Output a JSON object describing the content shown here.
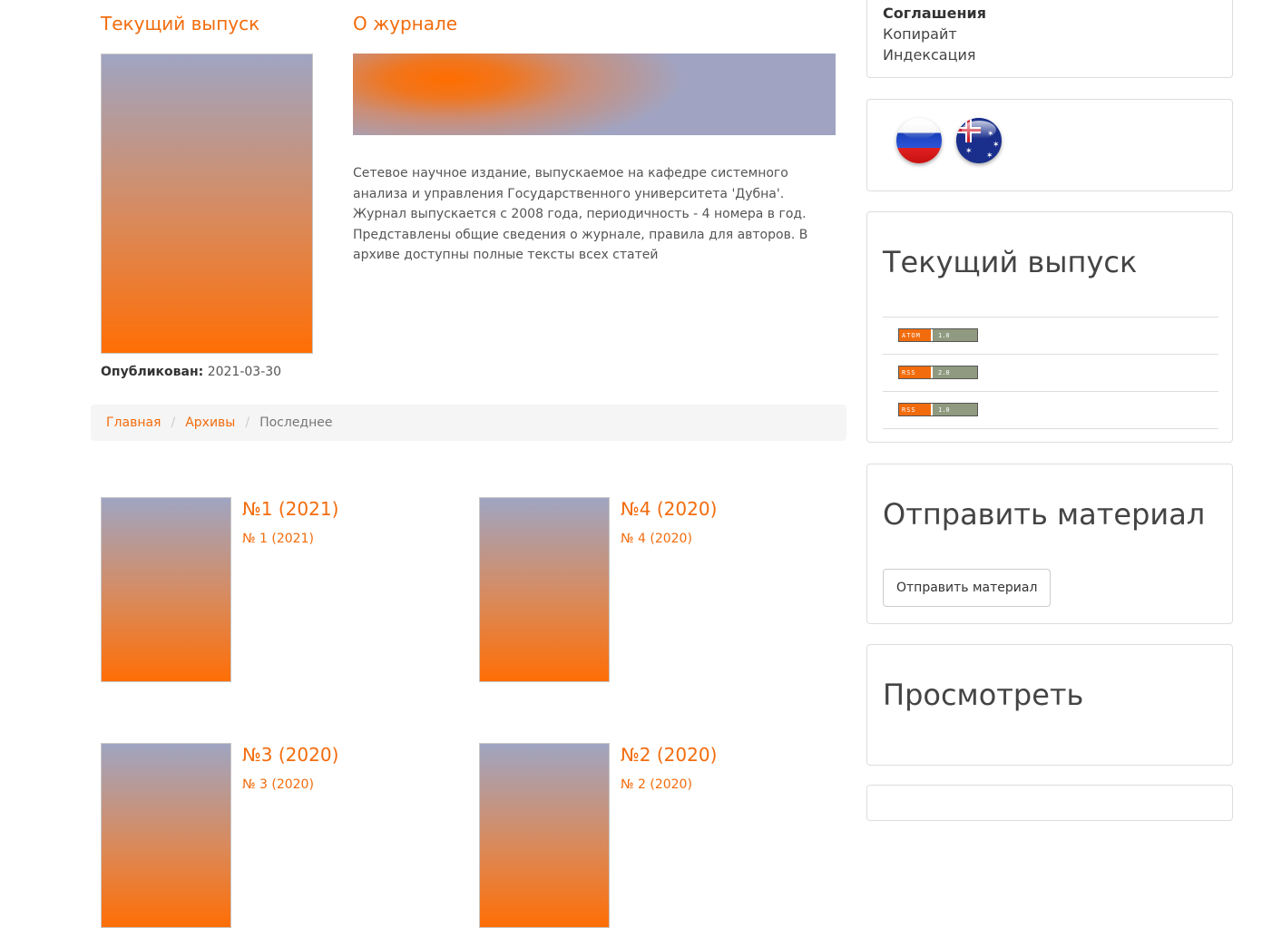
{
  "current_issue": {
    "heading": "Текущий выпуск",
    "published_label": "Опубликован:",
    "published_date": "2021-03-30"
  },
  "about": {
    "heading": "О журнале",
    "text": "Сетевое научное издание, выпускаемое на кафедре системного анализа и управления Государственного университета 'Дубна'. Журнал выпускается с 2008 года, периодичность - 4 номера в год. Представлены общие сведения о журнале, правила для авторов. В архиве доступны полные тексты всех статей"
  },
  "breadcrumb": {
    "home": "Главная",
    "archives": "Архивы",
    "current": "Последнее"
  },
  "issues": [
    {
      "title": "№1 (2021)",
      "subtitle": "№ 1 (2021)"
    },
    {
      "title": "№4 (2020)",
      "subtitle": "№ 4 (2020)"
    },
    {
      "title": "№3 (2020)",
      "subtitle": "№ 3 (2020)"
    },
    {
      "title": "№2 (2020)",
      "subtitle": "№ 2 (2020)"
    }
  ],
  "sidebar": {
    "agreements": {
      "heading": "Соглашения",
      "links": [
        "Копирайт",
        "Индексация"
      ]
    },
    "languages": {
      "icons": [
        "russia-flag-icon",
        "australia-flag-icon"
      ]
    },
    "current_issue": {
      "title": "Текущий выпуск",
      "feeds": [
        {
          "left": "ATOM",
          "right": "1.0"
        },
        {
          "left": "RSS",
          "right": "2.0"
        },
        {
          "left": "RSS",
          "right": "1.0"
        }
      ]
    },
    "submit": {
      "title": "Отправить материал",
      "button": "Отправить материал"
    },
    "browse": {
      "title": "Просмотреть"
    }
  },
  "colors": {
    "accent": "#f26c0d",
    "breadcrumb_bg": "#f5f5f5"
  }
}
